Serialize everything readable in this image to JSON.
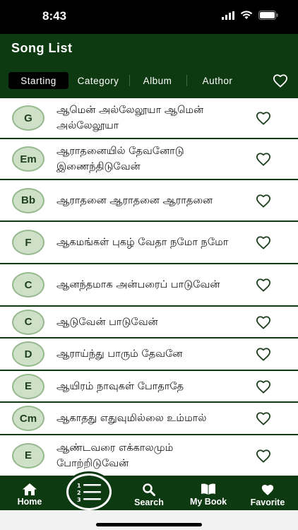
{
  "status": {
    "time": "8:43"
  },
  "header": {
    "title": "Song List"
  },
  "tabs": [
    {
      "label": "Starting",
      "active": true
    },
    {
      "label": "Category",
      "active": false
    },
    {
      "label": "Album",
      "active": false
    },
    {
      "label": "Author",
      "active": false
    }
  ],
  "songs": [
    {
      "chord": "G",
      "title": "ஆமென் அல்லேலூயா ஆமென் அல்லேலூயா"
    },
    {
      "chord": "Em",
      "title": "ஆராதனையில் தேவனோடு இணைந்திடுவேன்"
    },
    {
      "chord": "Bb",
      "title": "ஆராதனை ஆராதனை ஆராதனை"
    },
    {
      "chord": "F",
      "title": "ஆகமங்கள் புகழ் வேதா நமோ நமோ"
    },
    {
      "chord": "C",
      "title": "ஆனந்தமாக அன்பரைப் பாடுவேன்"
    },
    {
      "chord": "C",
      "title": "ஆடுவேன் பாடுவேன்"
    },
    {
      "chord": "D",
      "title": "ஆராய்ந்து பாரும் தேவனே"
    },
    {
      "chord": "E",
      "title": "ஆயிரம் நாவுகள் போதாதே"
    },
    {
      "chord": "Cm",
      "title": "ஆகாதது எதுவுமில்லை உம்மால்"
    },
    {
      "chord": "E",
      "title": "ஆண்டவரை எக்காலமும் போற்றிடுவேன்"
    }
  ],
  "nav": {
    "home": "Home",
    "search": "Search",
    "mybook": "My Book",
    "favorite": "Favorite"
  },
  "colors": {
    "primary": "#0e3a12",
    "chord_bg": "#cfe0c9"
  }
}
